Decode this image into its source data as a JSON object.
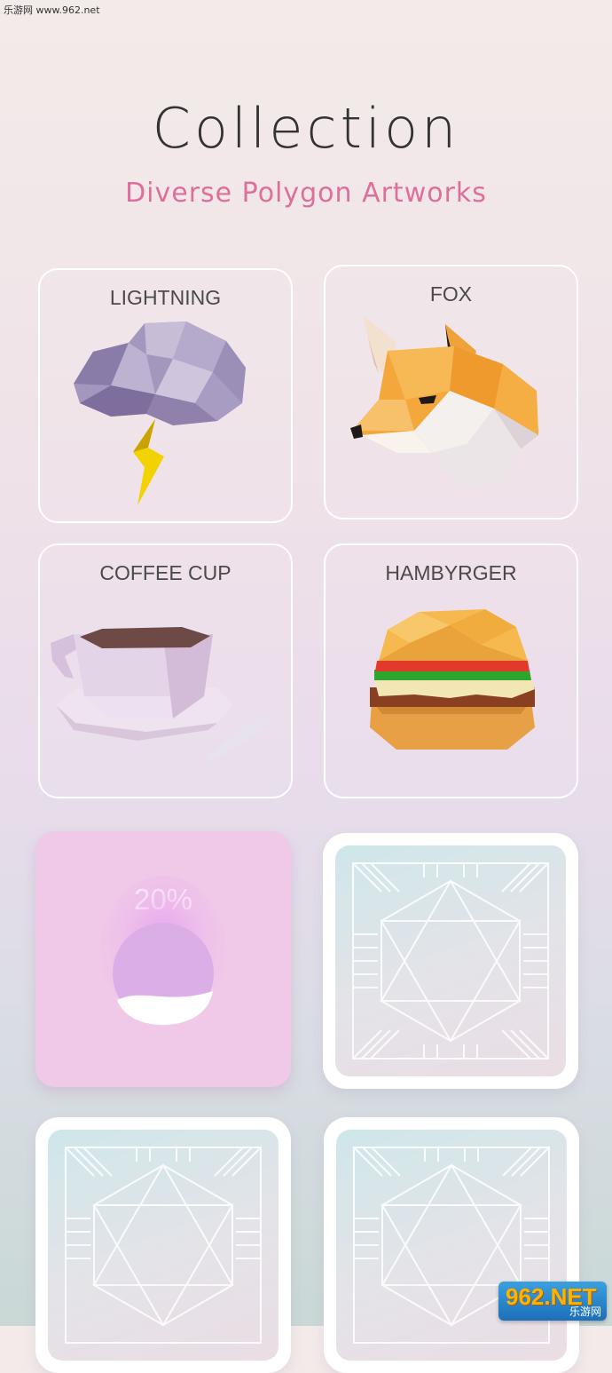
{
  "watermark": {
    "site": "乐游网 www.962.net",
    "logo_main": "962.NET",
    "logo_sub": "乐游网"
  },
  "header": {
    "title": "Collection",
    "subtitle": "Diverse Polygon Artworks"
  },
  "artworks": [
    {
      "label": "LIGHTNING",
      "icon": "lightning-cloud-icon"
    },
    {
      "label": "FOX",
      "icon": "fox-icon"
    },
    {
      "label": "COFFEE CUP",
      "icon": "coffee-cup-icon"
    },
    {
      "label": "HAMBYRGER",
      "icon": "hamburger-icon"
    }
  ],
  "in_progress": {
    "percent_label": "20%",
    "progress": 0.2
  },
  "locked_items": [
    {
      "icon": "locked-polygon-icon"
    },
    {
      "icon": "locked-polygon-icon"
    },
    {
      "icon": "locked-polygon-icon"
    }
  ],
  "colors": {
    "accent": "#dc6f9c",
    "progress_bg": "#f0c8e8"
  }
}
